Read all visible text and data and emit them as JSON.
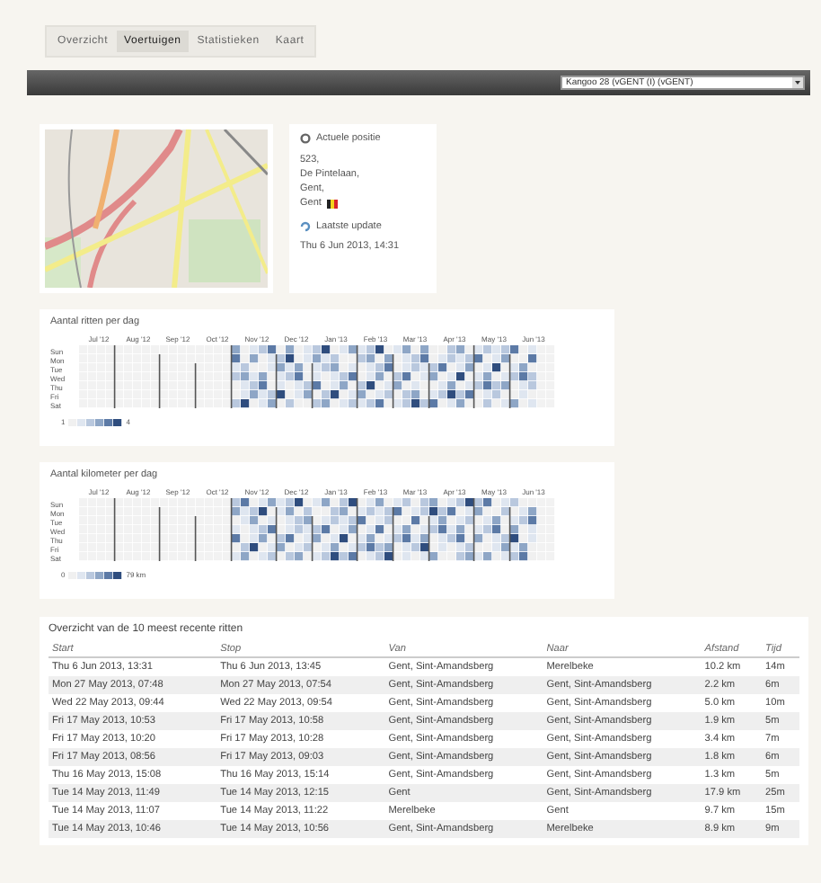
{
  "tabs": [
    {
      "label": "Overzicht",
      "selected": false
    },
    {
      "label": "Voertuigen",
      "selected": true
    },
    {
      "label": "Statistieken",
      "selected": false
    },
    {
      "label": "Kaart",
      "selected": false
    }
  ],
  "vehicle_select": {
    "value": "Kangoo 28 (vGENT (I) (vGENT)"
  },
  "position": {
    "title": "Actuele positie",
    "address": [
      "523,",
      "De Pintelaan,",
      "Gent,",
      "Gent"
    ],
    "update_title": "Laatste update",
    "update_time": "Thu 6 Jun 2013, 14:31"
  },
  "heatmaps": [
    {
      "title": "Aantal ritten per dag",
      "months": [
        "Jul '12",
        "Aug '12",
        "Sep '12",
        "Oct '12",
        "Nov '12",
        "Dec '12",
        "Jan '13",
        "Feb '13",
        "Mar '13",
        "Apr '13",
        "May '13",
        "Jun '13"
      ],
      "days": [
        "Sun",
        "Mon",
        "Tue",
        "Wed",
        "Thu",
        "Fri",
        "Sat"
      ],
      "legend_min": "1",
      "legend_max": "4"
    },
    {
      "title": "Aantal kilometer per dag",
      "months": [
        "Jul '12",
        "Aug '12",
        "Sep '12",
        "Oct '12",
        "Nov '12",
        "Dec '12",
        "Jan '13",
        "Feb '13",
        "Mar '13",
        "Apr '13",
        "May '13",
        "Jun '13"
      ],
      "days": [
        "Sun",
        "Mon",
        "Tue",
        "Wed",
        "Thu",
        "Fri",
        "Sat"
      ],
      "legend_min": "0",
      "legend_max": "79 km"
    }
  ],
  "trips": {
    "title": "Overzicht van de 10 meest recente ritten",
    "columns": [
      "Start",
      "Stop",
      "Van",
      "Naar",
      "Afstand",
      "Tijd"
    ],
    "rows": [
      [
        "Thu 6 Jun 2013, 13:31",
        "Thu 6 Jun 2013, 13:45",
        "Gent, Sint-Amandsberg",
        "Merelbeke",
        "10.2 km",
        "14m"
      ],
      [
        "Mon 27 May 2013, 07:48",
        "Mon 27 May 2013, 07:54",
        "Gent, Sint-Amandsberg",
        "Gent, Sint-Amandsberg",
        "2.2 km",
        "6m"
      ],
      [
        "Wed 22 May 2013, 09:44",
        "Wed 22 May 2013, 09:54",
        "Gent, Sint-Amandsberg",
        "Gent, Sint-Amandsberg",
        "5.0 km",
        "10m"
      ],
      [
        "Fri 17 May 2013, 10:53",
        "Fri 17 May 2013, 10:58",
        "Gent, Sint-Amandsberg",
        "Gent, Sint-Amandsberg",
        "1.9 km",
        "5m"
      ],
      [
        "Fri 17 May 2013, 10:20",
        "Fri 17 May 2013, 10:28",
        "Gent, Sint-Amandsberg",
        "Gent, Sint-Amandsberg",
        "3.4 km",
        "7m"
      ],
      [
        "Fri 17 May 2013, 08:56",
        "Fri 17 May 2013, 09:03",
        "Gent, Sint-Amandsberg",
        "Gent, Sint-Amandsberg",
        "1.8 km",
        "6m"
      ],
      [
        "Thu 16 May 2013, 15:08",
        "Thu 16 May 2013, 15:14",
        "Gent, Sint-Amandsberg",
        "Gent, Sint-Amandsberg",
        "1.3 km",
        "5m"
      ],
      [
        "Tue 14 May 2013, 11:49",
        "Tue 14 May 2013, 12:15",
        "Gent",
        "Gent, Sint-Amandsberg",
        "17.9 km",
        "25m"
      ],
      [
        "Tue 14 May 2013, 11:07",
        "Tue 14 May 2013, 11:22",
        "Merelbeke",
        "Gent",
        "9.7 km",
        "15m"
      ],
      [
        "Tue 14 May 2013, 10:46",
        "Tue 14 May 2013, 10:56",
        "Gent, Sint-Amandsberg",
        "Merelbeke",
        "8.9 km",
        "9m"
      ]
    ]
  }
}
